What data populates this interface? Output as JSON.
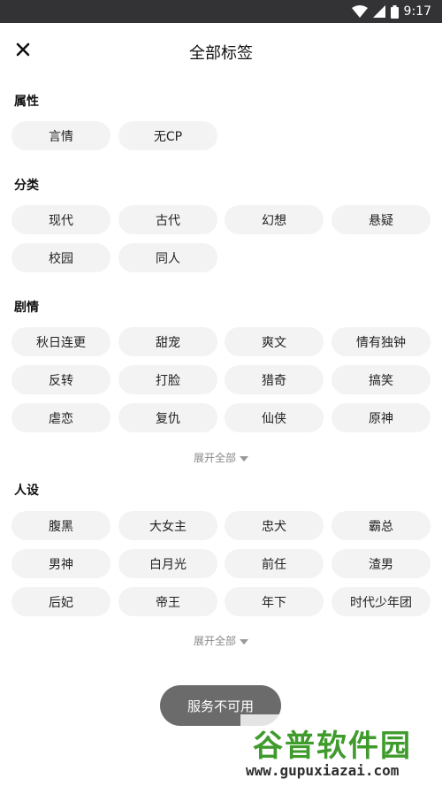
{
  "status_bar": {
    "time": "9:17"
  },
  "header": {
    "title": "全部标签",
    "close_icon": "close-icon"
  },
  "sections": {
    "attributes": {
      "title": "属性",
      "tags": [
        "言情",
        "无CP"
      ]
    },
    "category": {
      "title": "分类",
      "tags": [
        "现代",
        "古代",
        "幻想",
        "悬疑",
        "校园",
        "同人"
      ]
    },
    "plot": {
      "title": "剧情",
      "tags": [
        "秋日连更",
        "甜宠",
        "爽文",
        "情有独钟",
        "反转",
        "打脸",
        "猎奇",
        "搞笑",
        "虐恋",
        "复仇",
        "仙侠",
        "原神"
      ],
      "expand_label": "展开全部"
    },
    "persona": {
      "title": "人设",
      "tags": [
        "腹黑",
        "大女主",
        "忠犬",
        "霸总",
        "男神",
        "白月光",
        "前任",
        "渣男",
        "后妃",
        "帝王",
        "年下",
        "时代少年团"
      ],
      "expand_label": "展开全部"
    }
  },
  "toast": {
    "text": "服务不可用"
  },
  "watermark": {
    "logo_text": "谷普软件园",
    "url": "www.gupuxiazai.com"
  },
  "colors": {
    "tag_bg": "#f3f3f3",
    "status_bar": "#333335",
    "watermark_green": "#3f9b2c"
  }
}
